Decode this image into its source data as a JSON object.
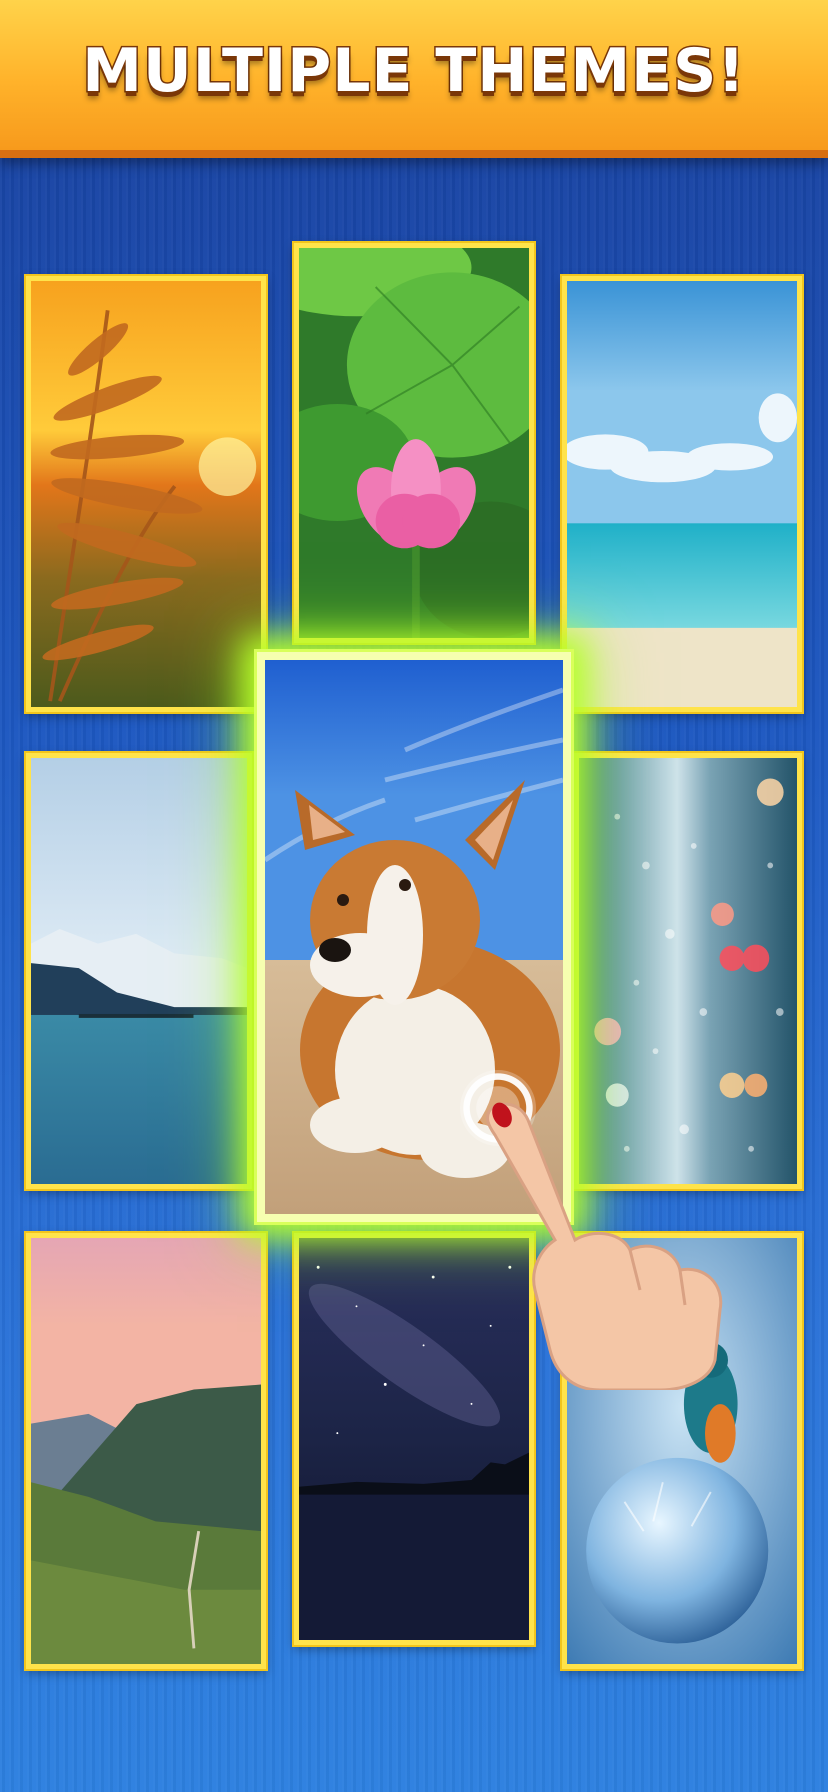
{
  "header": {
    "title": "MULTIPLE THEMES!"
  },
  "themes": [
    {
      "name": "golden-grass",
      "selected": false
    },
    {
      "name": "lotus",
      "selected": false
    },
    {
      "name": "beach",
      "selected": false
    },
    {
      "name": "mountain-lake",
      "selected": false
    },
    {
      "name": "corgi",
      "selected": true
    },
    {
      "name": "rainy-window",
      "selected": false
    },
    {
      "name": "valley-sunset",
      "selected": false
    },
    {
      "name": "starry-night",
      "selected": false
    },
    {
      "name": "kingfisher-bubble",
      "selected": false
    }
  ],
  "colors": {
    "banner": "#ffb22a",
    "tile_border": "#ffe34a",
    "selected_glow": "#b8ff2a",
    "background": "#1d57c0"
  },
  "icons": {
    "pointer": "pointing-hand-icon"
  }
}
